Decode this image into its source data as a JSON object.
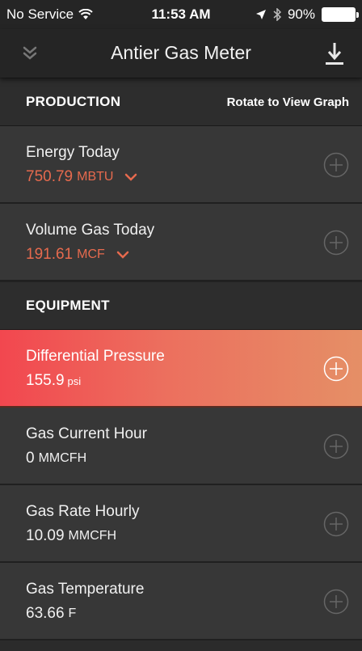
{
  "status_bar": {
    "carrier": "No Service",
    "time": "11:53 AM",
    "battery": "90%"
  },
  "nav": {
    "title": "Antier Gas Meter"
  },
  "production": {
    "label": "PRODUCTION",
    "hint": "Rotate to View Graph",
    "items": [
      {
        "name": "Energy Today",
        "value": "750.79",
        "unit": "MBTU"
      },
      {
        "name": "Volume Gas Today",
        "value": "191.61",
        "unit": "MCF"
      }
    ]
  },
  "equipment": {
    "label": "EQUIPMENT",
    "items": [
      {
        "name": "Differential Pressure",
        "value": "155.9",
        "unit": "psi"
      },
      {
        "name": "Gas Current Hour",
        "value": "0",
        "unit": "MMCFH"
      },
      {
        "name": "Gas Rate Hourly",
        "value": "10.09",
        "unit": "MMCFH"
      },
      {
        "name": "Gas Temperature",
        "value": "63.66",
        "unit": "F"
      }
    ]
  },
  "colors": {
    "accent": "#e66a4e",
    "active_start": "#f2474f",
    "active_end": "#e58f66"
  }
}
